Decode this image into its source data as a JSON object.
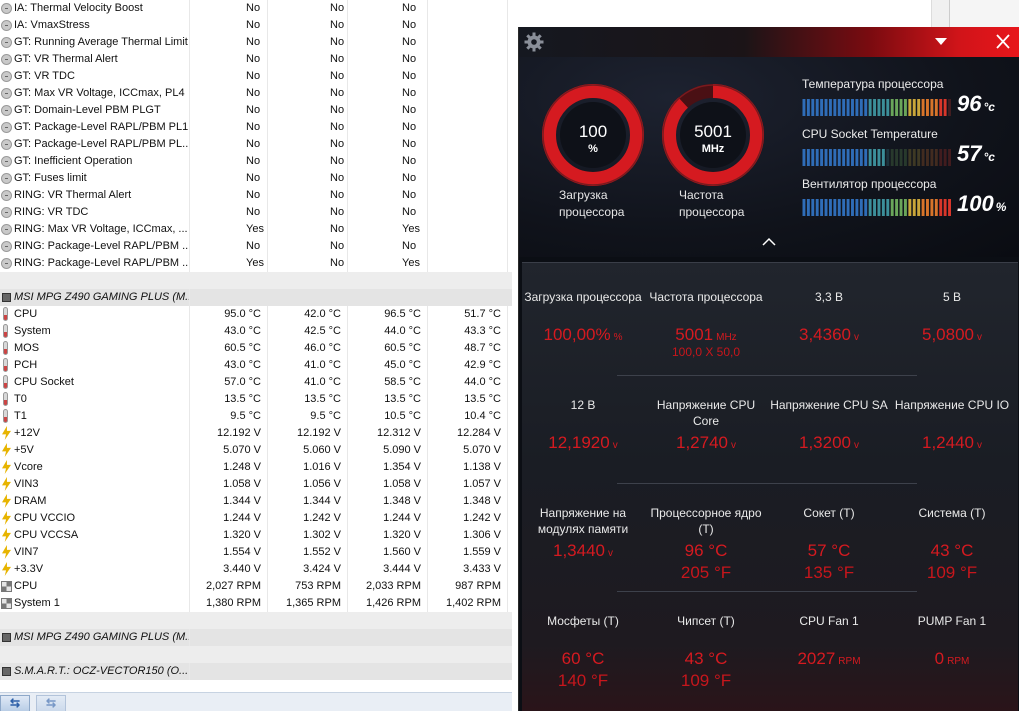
{
  "sensor_table": {
    "flag_rows": [
      {
        "name": "IA: Thermal Velocity Boost",
        "v1": "No",
        "v2": "No",
        "v3": "No"
      },
      {
        "name": "IA: VmaxStress",
        "v1": "No",
        "v2": "No",
        "v3": "No"
      },
      {
        "name": "GT: Running Average Thermal Limit",
        "v1": "No",
        "v2": "No",
        "v3": "No"
      },
      {
        "name": "GT: VR Thermal Alert",
        "v1": "No",
        "v2": "No",
        "v3": "No"
      },
      {
        "name": "GT: VR TDC",
        "v1": "No",
        "v2": "No",
        "v3": "No"
      },
      {
        "name": "GT: Max VR Voltage, ICCmax, PL4",
        "v1": "No",
        "v2": "No",
        "v3": "No"
      },
      {
        "name": "GT: Domain-Level PBM PLGT",
        "v1": "No",
        "v2": "No",
        "v3": "No"
      },
      {
        "name": "GT: Package-Level RAPL/PBM PL1",
        "v1": "No",
        "v2": "No",
        "v3": "No"
      },
      {
        "name": "GT: Package-Level RAPL/PBM PL...",
        "v1": "No",
        "v2": "No",
        "v3": "No"
      },
      {
        "name": "GT: Inefficient Operation",
        "v1": "No",
        "v2": "No",
        "v3": "No"
      },
      {
        "name": "GT: Fuses limit",
        "v1": "No",
        "v2": "No",
        "v3": "No"
      },
      {
        "name": "RING: VR Thermal Alert",
        "v1": "No",
        "v2": "No",
        "v3": "No"
      },
      {
        "name": "RING: VR TDC",
        "v1": "No",
        "v2": "No",
        "v3": "No"
      },
      {
        "name": "RING: Max VR Voltage, ICCmax, ...",
        "v1": "Yes",
        "v2": "No",
        "v3": "Yes"
      },
      {
        "name": "RING: Package-Level RAPL/PBM ...",
        "v1": "No",
        "v2": "No",
        "v3": "No"
      },
      {
        "name": "RING: Package-Level RAPL/PBM ...",
        "v1": "Yes",
        "v2": "No",
        "v3": "Yes"
      }
    ],
    "section_mb1": "MSI MPG Z490 GAMING PLUS (M...",
    "sensor_rows": [
      {
        "icon": "thermometer-icon",
        "name": "CPU",
        "v1": "95.0 °C",
        "v2": "42.0 °C",
        "v3": "96.5 °C",
        "v4": "51.7 °C"
      },
      {
        "icon": "thermometer-icon",
        "name": "System",
        "v1": "43.0 °C",
        "v2": "42.5 °C",
        "v3": "44.0 °C",
        "v4": "43.3 °C"
      },
      {
        "icon": "thermometer-icon",
        "name": "MOS",
        "v1": "60.5 °C",
        "v2": "46.0 °C",
        "v3": "60.5 °C",
        "v4": "48.7 °C"
      },
      {
        "icon": "thermometer-icon",
        "name": "PCH",
        "v1": "43.0 °C",
        "v2": "41.0 °C",
        "v3": "45.0 °C",
        "v4": "42.9 °C"
      },
      {
        "icon": "thermometer-icon",
        "name": "CPU Socket",
        "v1": "57.0 °C",
        "v2": "41.0 °C",
        "v3": "58.5 °C",
        "v4": "44.0 °C"
      },
      {
        "icon": "thermometer-icon",
        "name": "T0",
        "v1": "13.5 °C",
        "v2": "13.5 °C",
        "v3": "13.5 °C",
        "v4": "13.5 °C"
      },
      {
        "icon": "thermometer-icon",
        "name": "T1",
        "v1": "9.5 °C",
        "v2": "9.5 °C",
        "v3": "10.5 °C",
        "v4": "10.4 °C"
      },
      {
        "icon": "voltage-icon",
        "name": "+12V",
        "v1": "12.192 V",
        "v2": "12.192 V",
        "v3": "12.312 V",
        "v4": "12.284 V"
      },
      {
        "icon": "voltage-icon",
        "name": "+5V",
        "v1": "5.070 V",
        "v2": "5.060 V",
        "v3": "5.090 V",
        "v4": "5.070 V"
      },
      {
        "icon": "voltage-icon",
        "name": "Vcore",
        "v1": "1.248 V",
        "v2": "1.016 V",
        "v3": "1.354 V",
        "v4": "1.138 V"
      },
      {
        "icon": "voltage-icon",
        "name": "VIN3",
        "v1": "1.058 V",
        "v2": "1.056 V",
        "v3": "1.058 V",
        "v4": "1.057 V"
      },
      {
        "icon": "voltage-icon",
        "name": "DRAM",
        "v1": "1.344 V",
        "v2": "1.344 V",
        "v3": "1.348 V",
        "v4": "1.348 V"
      },
      {
        "icon": "voltage-icon",
        "name": "CPU VCCIO",
        "v1": "1.244 V",
        "v2": "1.242 V",
        "v3": "1.244 V",
        "v4": "1.242 V"
      },
      {
        "icon": "voltage-icon",
        "name": "CPU VCCSA",
        "v1": "1.320 V",
        "v2": "1.302 V",
        "v3": "1.320 V",
        "v4": "1.306 V"
      },
      {
        "icon": "voltage-icon",
        "name": "VIN7",
        "v1": "1.554 V",
        "v2": "1.552 V",
        "v3": "1.560 V",
        "v4": "1.559 V"
      },
      {
        "icon": "voltage-icon",
        "name": "+3.3V",
        "v1": "3.440 V",
        "v2": "3.424 V",
        "v3": "3.444 V",
        "v4": "3.433 V"
      },
      {
        "icon": "fan-icon",
        "name": "CPU",
        "v1": "2,027 RPM",
        "v2": "753 RPM",
        "v3": "2,033 RPM",
        "v4": "987 RPM"
      },
      {
        "icon": "fan-icon",
        "name": "System 1",
        "v1": "1,380 RPM",
        "v2": "1,365 RPM",
        "v3": "1,426 RPM",
        "v4": "1,402 RPM"
      }
    ],
    "section_mb2": "MSI MPG Z490 GAMING PLUS (M...",
    "section_smart": "S.M.A.R.T.: OCZ-VECTOR150 (O...",
    "nav_back": "⇆",
    "nav_forward": "⇆"
  },
  "monitor": {
    "gauges": [
      {
        "value": "100",
        "unit": "%",
        "label_line1": "Загрузка",
        "label_line2": "процессора",
        "level": 1.0
      },
      {
        "value": "5001",
        "unit": "MHz",
        "label_line1": "Частота",
        "label_line2": "процессора",
        "level": 0.88
      }
    ],
    "bars": [
      {
        "label": "Температура процессора",
        "value": "96",
        "unit": "°c",
        "level": 0.96
      },
      {
        "label": "CPU Socket Temperature",
        "value": "57",
        "unit": "°c",
        "level": 0.57
      },
      {
        "label": "Вентилятор процессора",
        "value": "100",
        "unit": "%",
        "level": 1.0
      }
    ],
    "tiles": [
      {
        "label": "Загрузка процессора",
        "value": "100,00%",
        "unit": "%",
        "sub": ""
      },
      {
        "label": "Частота процессора",
        "value": "5001",
        "unit": "MHz",
        "sub": "100,0 X 50,0"
      },
      {
        "label": "3,3 В",
        "value": "3,4360",
        "unit": "v",
        "sub": ""
      },
      {
        "label": "5 В",
        "value": "5,0800",
        "unit": "v",
        "sub": ""
      },
      {
        "label": "12 В",
        "value": "12,1920",
        "unit": "v",
        "sub": ""
      },
      {
        "label": "Напряжение CPU Core",
        "value": "1,2740",
        "unit": "v",
        "sub": ""
      },
      {
        "label": "Напряжение CPU SA",
        "value": "1,3200",
        "unit": "v",
        "sub": ""
      },
      {
        "label": "Напряжение CPU IO",
        "value": "1,2440",
        "unit": "v",
        "sub": ""
      },
      {
        "label": "Напряжение на модулях памяти",
        "value": "1,3440",
        "unit": "v",
        "sub": ""
      },
      {
        "label": "Процессорное ядро (Т)",
        "value": "96 °C",
        "unit": "",
        "sub": "205 °F"
      },
      {
        "label": "Сокет (Т)",
        "value": "57 °C",
        "unit": "",
        "sub": "135 °F"
      },
      {
        "label": "Система (Т)",
        "value": "43 °C",
        "unit": "",
        "sub": "109 °F"
      },
      {
        "label": "Мосфеты (Т)",
        "value": "60 °C",
        "unit": "",
        "sub": "140 °F"
      },
      {
        "label": "Чипсет (Т)",
        "value": "43 °C",
        "unit": "",
        "sub": "109 °F"
      },
      {
        "label": "CPU Fan 1",
        "value": "2027",
        "unit": "RPM",
        "sub": ""
      },
      {
        "label": "PUMP Fan 1",
        "value": "0",
        "unit": "RPM",
        "sub": ""
      }
    ]
  },
  "colors": {
    "accent_red": "#d51a20",
    "header_red": "#e8161b",
    "panel_dark": "#0b0e14"
  }
}
